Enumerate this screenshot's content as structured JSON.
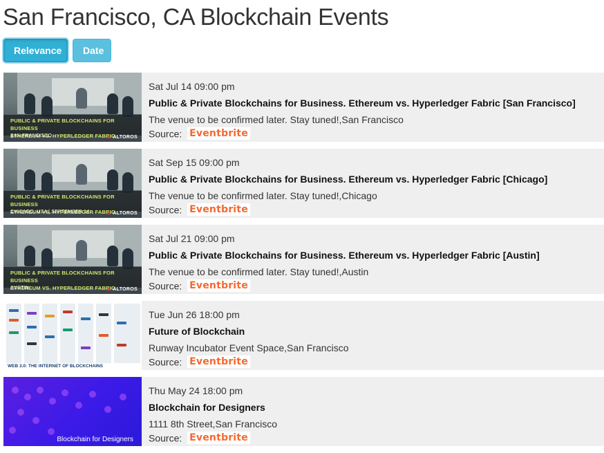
{
  "page": {
    "title": "San Francisco, CA Blockchain Events"
  },
  "sort": {
    "relevance_label": "Relevance",
    "date_label": "Date",
    "active": "relevance"
  },
  "events": [
    {
      "date": "Sat Jul 14 09:00 pm",
      "title": "Public & Private Blockchains for Business. Ethereum vs. Hyperledger Fabric [San Francisco]",
      "venue": "The venue to be confirmed later. Stay tuned!,San Francisco",
      "source_label": "Source:",
      "source_name": "Eventbrite",
      "thumbnail": {
        "kind": "altoros",
        "line1": "PUBLIC & PRIVATE BLOCKCHAINS FOR BUSINESS",
        "line2": "ETHEREUM VS. HYPERLEDGER FABRIC",
        "caption": "SAN FRANCISCO",
        "brand": "ALTOROS"
      }
    },
    {
      "date": "Sat Sep 15 09:00 pm",
      "title": "Public & Private Blockchains for Business. Ethereum vs. Hyperledger Fabric [Chicago]",
      "venue": "The venue to be confirmed later. Stay tuned!,Chicago",
      "source_label": "Source:",
      "source_name": "Eventbrite",
      "thumbnail": {
        "kind": "altoros",
        "line1": "PUBLIC & PRIVATE BLOCKCHAINS FOR BUSINESS",
        "line2": "ETHEREUM VS. HYPERLEDGER FABRIC",
        "caption": "CHICAGO, USA | SEPTEMBER 14",
        "brand": "ALTOROS"
      }
    },
    {
      "date": "Sat Jul 21 09:00 pm",
      "title": "Public & Private Blockchains for Business. Ethereum vs. Hyperledger Fabric [Austin]",
      "venue": "The venue to be confirmed later. Stay tuned!,Austin",
      "source_label": "Source:",
      "source_name": "Eventbrite",
      "thumbnail": {
        "kind": "altoros",
        "line1": "PUBLIC & PRIVATE BLOCKCHAINS FOR BUSINESS",
        "line2": "ETHEREUM VS. HYPERLEDGER FABRIC",
        "caption": "AUSTIN",
        "brand": "ALTOROS"
      }
    },
    {
      "date": "Tue Jun 26 18:00 pm",
      "title": "Future of Blockchain",
      "venue": "Runway Incubator Event Space,San Francisco",
      "source_label": "Source:",
      "source_name": "Eventbrite",
      "thumbnail": {
        "kind": "web3",
        "caption": "WEB 3.0: THE INTERNET OF BLOCKCHAINS"
      }
    },
    {
      "date": "Thu May 24 18:00 pm",
      "title": "Blockchain for Designers",
      "venue": "1111 8th Street,San Francisco",
      "source_label": "Source:",
      "source_name": "Eventbrite",
      "thumbnail": {
        "kind": "design",
        "caption": "Blockchain for Designers"
      }
    }
  ],
  "colors": {
    "button": "#5bc0de",
    "row_bg": "#efefef",
    "eventbrite": "#f6682f"
  },
  "icons": {
    "source_logo": "eventbrite-logo"
  }
}
